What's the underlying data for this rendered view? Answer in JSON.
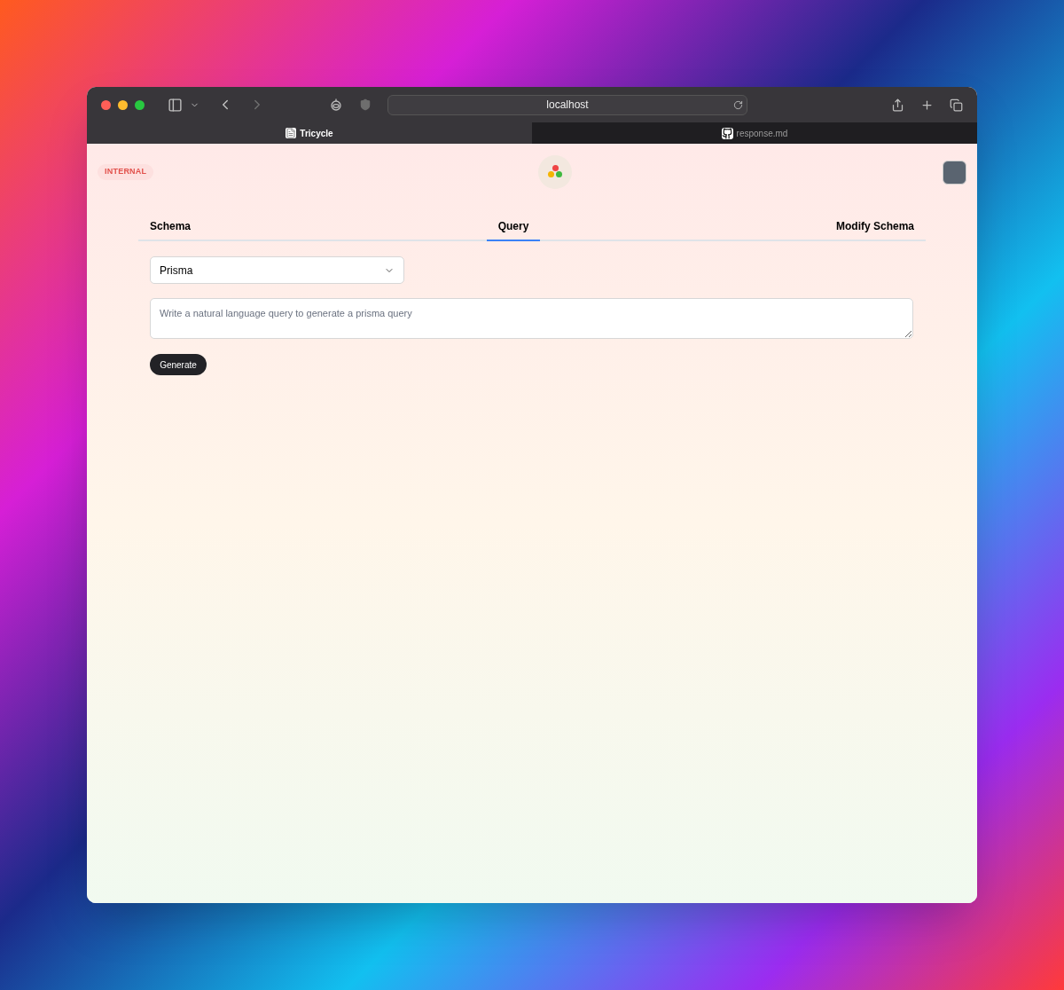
{
  "browser": {
    "address": "localhost",
    "tabs": [
      {
        "label": "Tricycle",
        "selected": true
      },
      {
        "label": "response.md",
        "selected": false
      }
    ]
  },
  "header": {
    "badge": "INTERNAL"
  },
  "tabs": [
    {
      "label": "Schema",
      "selected": false
    },
    {
      "label": "Query",
      "selected": true
    },
    {
      "label": "Modify Schema",
      "selected": false
    }
  ],
  "select": {
    "value": "Prisma"
  },
  "query_field": {
    "placeholder": "Write a natural language query to generate a prisma query"
  },
  "buttons": [
    "Generate"
  ]
}
